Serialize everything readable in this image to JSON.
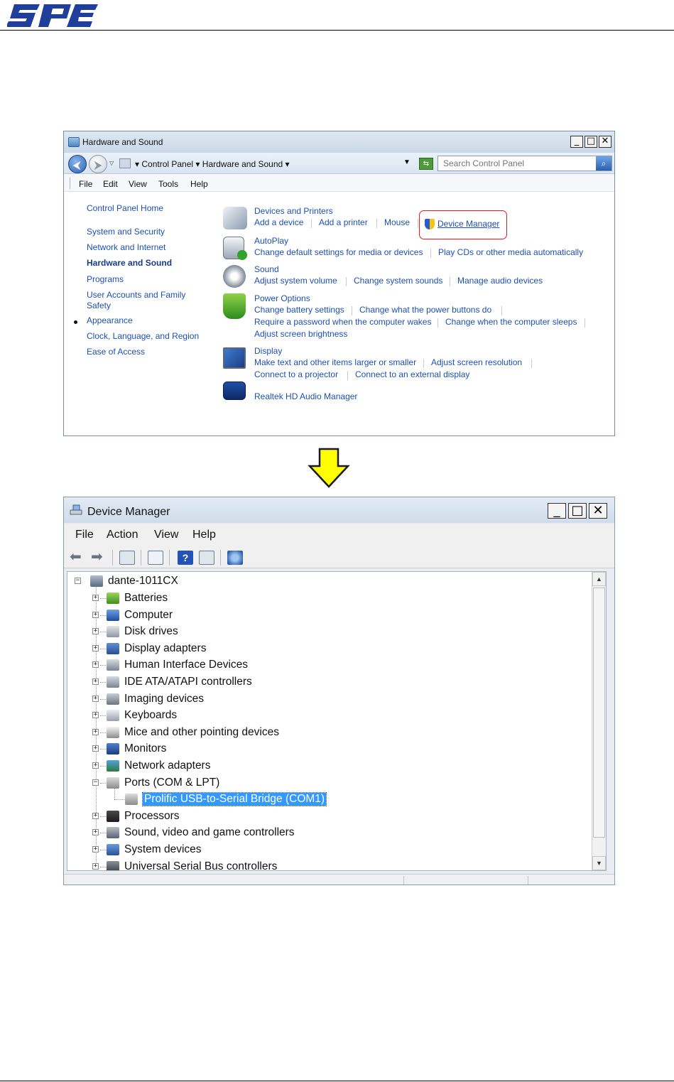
{
  "brand": {
    "logo_text": "SPE",
    "logo_color": "#1f3f9a"
  },
  "control_panel": {
    "title": "Hardware and Sound",
    "breadcrumb": [
      "Control Panel",
      "Hardware and Sound"
    ],
    "search_placeholder": "Search Control Panel",
    "menu": [
      "File",
      "Edit",
      "View",
      "Tools",
      "Help"
    ],
    "sidebar": [
      "Control Panel Home",
      "System and Security",
      "Network and Internet",
      "Hardware and Sound",
      "Programs",
      "User Accounts and Family Safety",
      "Appearance",
      "Clock, Language, and Region",
      "Ease of Access"
    ],
    "sidebar_current": "Hardware and Sound",
    "categories": {
      "devices": {
        "title": "Devices and Printers",
        "links": [
          "Add a device",
          "Add a printer",
          "Mouse",
          "Device Manager"
        ]
      },
      "autoplay": {
        "title": "AutoPlay",
        "links": [
          "Change default settings for media or devices",
          "Play CDs or other media automatically"
        ]
      },
      "sound": {
        "title": "Sound",
        "links": [
          "Adjust system volume",
          "Change system sounds",
          "Manage audio devices"
        ]
      },
      "power": {
        "title": "Power Options",
        "links": [
          "Change battery settings",
          "Change what the power buttons do",
          "Require a password when the computer wakes",
          "Change when the computer sleeps",
          "Adjust screen brightness"
        ]
      },
      "display": {
        "title": "Display",
        "links": [
          "Make text and other items larger or smaller",
          "Adjust screen resolution",
          "Connect to a projector",
          "Connect to an external display"
        ]
      },
      "realtek": {
        "title": "Realtek HD Audio Manager"
      }
    },
    "highlight_color": "#d81f26"
  },
  "device_manager": {
    "title": "Device Manager",
    "menu": [
      "File",
      "Action",
      "View",
      "Help"
    ],
    "tree_root": "dante-1011CX",
    "tree": [
      {
        "label": "Batteries",
        "icon": "battery-icon",
        "expanded": false
      },
      {
        "label": "Computer",
        "icon": "computer-icon",
        "expanded": false
      },
      {
        "label": "Disk drives",
        "icon": "disk-drive-icon",
        "expanded": false
      },
      {
        "label": "Display adapters",
        "icon": "display-adapter-icon",
        "expanded": false
      },
      {
        "label": "Human Interface Devices",
        "icon": "hid-icon",
        "expanded": false
      },
      {
        "label": "IDE ATA/ATAPI controllers",
        "icon": "ide-controller-icon",
        "expanded": false
      },
      {
        "label": "Imaging devices",
        "icon": "imaging-device-icon",
        "expanded": false
      },
      {
        "label": "Keyboards",
        "icon": "keyboard-icon",
        "expanded": false
      },
      {
        "label": "Mice and other pointing devices",
        "icon": "mouse-icon",
        "expanded": false
      },
      {
        "label": "Monitors",
        "icon": "monitor-icon",
        "expanded": false
      },
      {
        "label": "Network adapters",
        "icon": "network-adapter-icon",
        "expanded": false
      },
      {
        "label": "Ports (COM & LPT)",
        "icon": "port-icon",
        "expanded": true
      },
      {
        "label": "Prolific USB-to-Serial Bridge (COM1)",
        "icon": "port-icon",
        "child": true,
        "selected": true
      },
      {
        "label": "Processors",
        "icon": "processor-icon",
        "expanded": false
      },
      {
        "label": "Sound, video and game controllers",
        "icon": "sound-icon",
        "expanded": false
      },
      {
        "label": "System devices",
        "icon": "system-device-icon",
        "expanded": false
      },
      {
        "label": "Universal Serial Bus controllers",
        "icon": "usb-icon",
        "expanded": false
      }
    ],
    "selection_color": "#3399ff"
  },
  "arrow_color": "#ffff00"
}
